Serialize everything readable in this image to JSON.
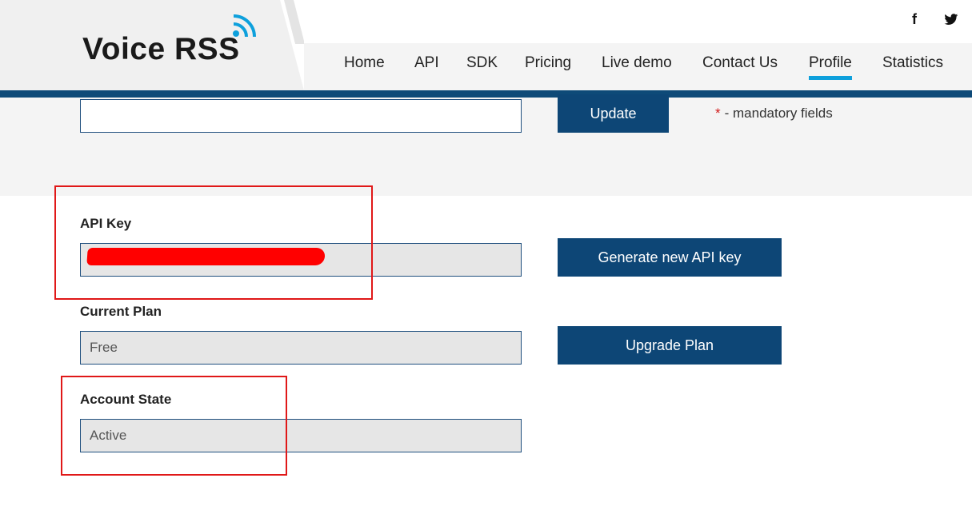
{
  "brand": {
    "logo_text": "Voice RSS",
    "logo_icon": "wifi-signal-icon",
    "accent": "#0ea0dc",
    "bar_color": "#0e4a78"
  },
  "social": {
    "facebook": "f",
    "twitter": "twitter-bird-icon"
  },
  "nav": {
    "items": [
      {
        "label": "Home"
      },
      {
        "label": "API"
      },
      {
        "label": "SDK"
      },
      {
        "label": "Pricing"
      },
      {
        "label": "Live demo"
      },
      {
        "label": "Contact Us"
      },
      {
        "label": "Profile",
        "active": true
      },
      {
        "label": "Statistics"
      }
    ]
  },
  "form": {
    "top_input_value": "",
    "update_label": "Update",
    "mandatory_star": "*",
    "mandatory_text": "- mandatory fields"
  },
  "api_key": {
    "label": "API Key",
    "value_redacted": true,
    "generate_label": "Generate new API key"
  },
  "plan": {
    "label": "Current Plan",
    "value": "Free",
    "upgrade_label": "Upgrade Plan"
  },
  "account": {
    "label": "Account State",
    "value": "Active"
  },
  "colors": {
    "button": "#0d4676",
    "highlight": "#e01818",
    "redaction": "#ff0000"
  }
}
